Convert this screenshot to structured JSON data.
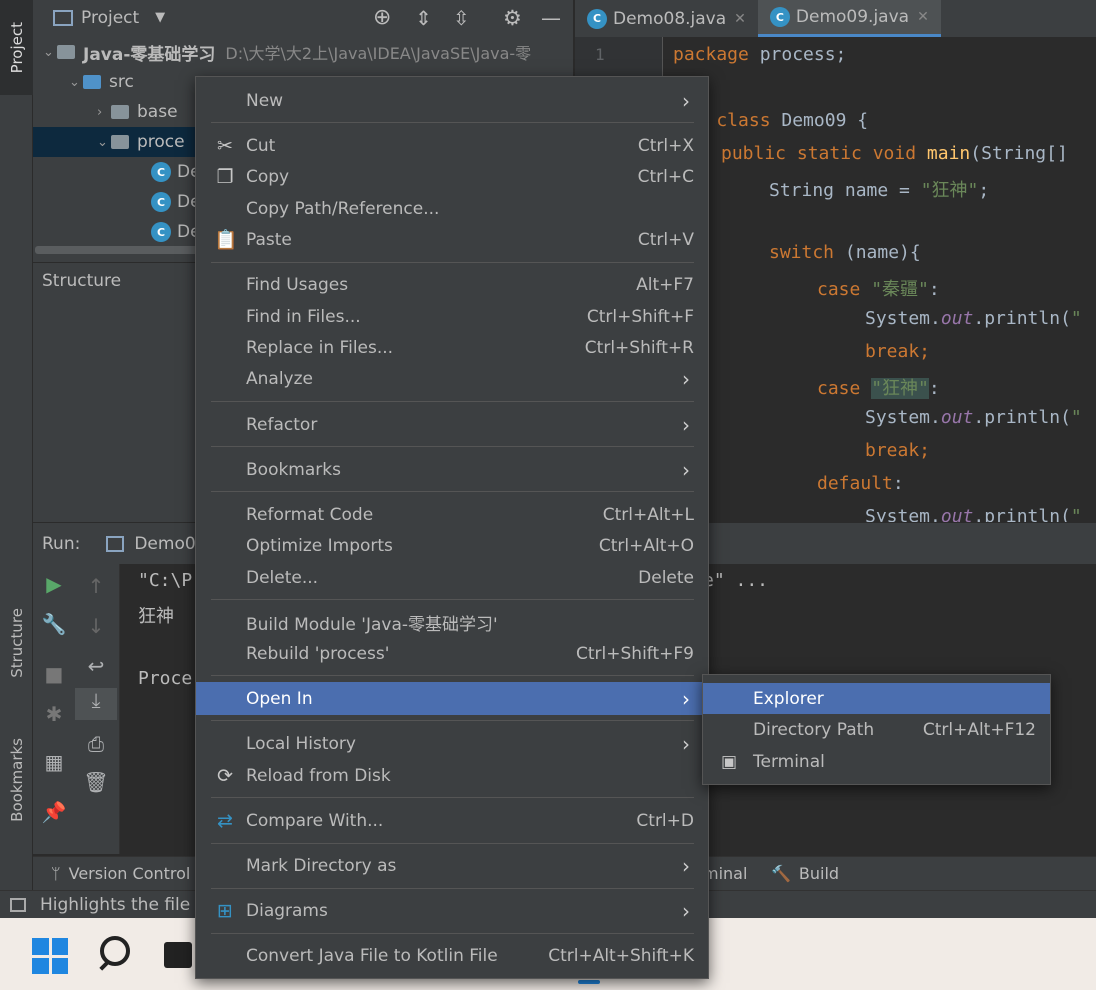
{
  "left_strip": {
    "project_tab": "Project",
    "structure_tab": "Structure",
    "bookmarks_tab": "Bookmarks"
  },
  "project_panel": {
    "title": "Project",
    "tree": [
      {
        "label": "Java-零基础学习",
        "path": "D:\\大学\\大2上\\Java\\IDEA\\JavaSE\\Java-零"
      },
      {
        "label": "src"
      },
      {
        "label": "base"
      },
      {
        "label": "proce"
      },
      {
        "label": "De"
      },
      {
        "label": "De"
      },
      {
        "label": "De"
      }
    ]
  },
  "structure_panel": {
    "title": "Structure"
  },
  "editor": {
    "tabs": [
      {
        "label": "Demo08.java",
        "active": false
      },
      {
        "label": "Demo09.java",
        "active": true
      }
    ],
    "line_number": "1"
  },
  "run_panel": {
    "label": "Run:",
    "config": "Demo0",
    "console": [
      "\"C:\\P",
      "狂神",
      "Proce"
    ],
    "console_tail": "e\" ..."
  },
  "bottom_tabs": {
    "version_control": "Version Control",
    "terminal_fragment": "minal",
    "build": "Build"
  },
  "status_bar": {
    "text": "Highlights the file"
  },
  "context_menu": {
    "items": [
      {
        "label": "New",
        "submenu": true
      },
      {
        "label": "Cut",
        "shortcut": "Ctrl+X",
        "icon": "scissors-icon"
      },
      {
        "label": "Copy",
        "shortcut": "Ctrl+C",
        "icon": "copy-icon"
      },
      {
        "label": "Copy Path/Reference..."
      },
      {
        "label": "Paste",
        "shortcut": "Ctrl+V",
        "icon": "paste-icon"
      },
      {
        "label": "Find Usages",
        "shortcut": "Alt+F7"
      },
      {
        "label": "Find in Files...",
        "shortcut": "Ctrl+Shift+F"
      },
      {
        "label": "Replace in Files...",
        "shortcut": "Ctrl+Shift+R"
      },
      {
        "label": "Analyze",
        "submenu": true
      },
      {
        "label": "Refactor",
        "submenu": true
      },
      {
        "label": "Bookmarks",
        "submenu": true
      },
      {
        "label": "Reformat Code",
        "shortcut": "Ctrl+Alt+L"
      },
      {
        "label": "Optimize Imports",
        "shortcut": "Ctrl+Alt+O"
      },
      {
        "label": "Delete...",
        "shortcut": "Delete"
      },
      {
        "label": "Build Module 'Java-零基础学习'"
      },
      {
        "label": "Rebuild 'process'",
        "shortcut": "Ctrl+Shift+F9"
      },
      {
        "label": "Open In",
        "submenu": true,
        "highlighted": true
      },
      {
        "label": "Local History",
        "submenu": true
      },
      {
        "label": "Reload from Disk",
        "icon": "reload-icon"
      },
      {
        "label": "Compare With...",
        "shortcut": "Ctrl+D",
        "icon": "compare-icon"
      },
      {
        "label": "Mark Directory as",
        "submenu": true
      },
      {
        "label": "Diagrams",
        "submenu": true,
        "icon": "diagram-icon"
      },
      {
        "label": "Convert Java File to Kotlin File",
        "shortcut": "Ctrl+Alt+Shift+K"
      }
    ]
  },
  "submenu": {
    "items": [
      {
        "label": "Explorer",
        "highlighted": true
      },
      {
        "label": "Directory Path",
        "shortcut": "Ctrl+Alt+F12"
      },
      {
        "label": "Terminal",
        "icon": "terminal-icon"
      }
    ]
  },
  "colors": {
    "accent": "#4b6eaf",
    "keyword": "#cc7832",
    "string": "#6a8759",
    "field": "#9876aa",
    "method": "#ffc66d"
  }
}
